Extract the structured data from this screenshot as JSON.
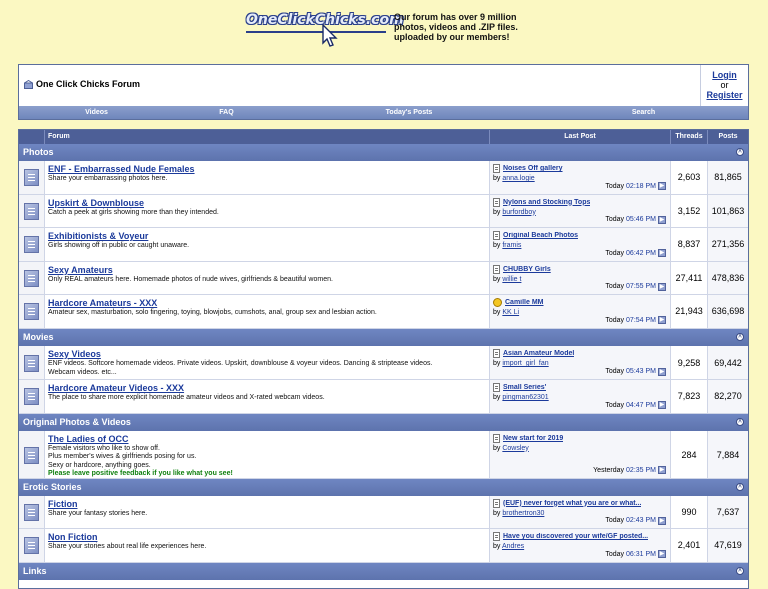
{
  "banner": {
    "logo_text": "OneClickChicks.com",
    "tagline": "Our forum has over 9 million photos, videos and .ZIP files. uploaded by our members!"
  },
  "navbox": {
    "title": "One Click Chicks Forum",
    "login": "Login",
    "or": "or",
    "register": "Register",
    "links": [
      "Videos",
      "FAQ",
      "Today's Posts",
      "Search"
    ]
  },
  "columns": {
    "forum": "Forum",
    "last_post": "Last Post",
    "threads": "Threads",
    "posts": "Posts"
  },
  "categories": [
    {
      "name": "Photos",
      "forums": [
        {
          "title": "ENF - Embarrassed Nude Females",
          "desc": [
            "Share your embarrassing photos here."
          ],
          "last_title": "Noises Off gallery",
          "by": "by",
          "last_user": "anna.logie",
          "day": "Today",
          "time": "02:18 PM",
          "threads": "2,603",
          "posts": "81,865",
          "icon": "doc"
        },
        {
          "title": "Upskirt & Downblouse",
          "desc": [
            "Catch a peek at girls showing more than they intended."
          ],
          "last_title": "Nylons and Stocking Tops",
          "by": "by",
          "last_user": "burfordboy",
          "day": "Today",
          "time": "05:46 PM",
          "threads": "3,152",
          "posts": "101,863",
          "icon": "doc"
        },
        {
          "title": "Exhibitionists & Voyeur",
          "desc": [
            "Girls showing off in public or caught unaware."
          ],
          "last_title": "Original Beach Photos",
          "by": "by",
          "last_user": "framis",
          "day": "Today",
          "time": "06:42 PM",
          "threads": "8,837",
          "posts": "271,356",
          "icon": "doc"
        },
        {
          "title": "Sexy Amateurs",
          "desc": [
            "Only REAL amateurs here. Homemade photos of nude wives, girlfriends & beautiful women."
          ],
          "last_title": "CHUBBY Girls",
          "by": "by",
          "last_user": "willie t",
          "day": "Today",
          "time": "07:55 PM",
          "threads": "27,411",
          "posts": "478,836",
          "icon": "doc"
        },
        {
          "title": "Hardcore Amateurs - XXX",
          "desc": [
            "Amateur sex, masturbation, solo fingering, toying, blowjobs, cumshots, anal, group sex and lesbian action."
          ],
          "last_title": "Camille MM",
          "by": "by",
          "last_user": "KK Li",
          "day": "Today",
          "time": "07:54 PM",
          "threads": "21,943",
          "posts": "636,698",
          "icon": "smile"
        }
      ]
    },
    {
      "name": "Movies",
      "forums": [
        {
          "title": "Sexy Videos",
          "desc": [
            "ENF videos. Softcore homemade videos. Private videos. Upskirt, downblouse & voyeur videos. Dancing & striptease videos.",
            "Webcam videos. etc..."
          ],
          "last_title": "Asian Amateur Model",
          "by": "by",
          "last_user": "import_girl_fan",
          "day": "Today",
          "time": "05:43 PM",
          "threads": "9,258",
          "posts": "69,442",
          "icon": "doc"
        },
        {
          "title": "Hardcore Amateur Videos - XXX",
          "desc": [
            "The place to share more explicit homemade amateur videos and X-rated webcam videos."
          ],
          "last_title": "Small Series'",
          "by": "by",
          "last_user": "pingman62301",
          "day": "Today",
          "time": "04:47 PM",
          "threads": "7,823",
          "posts": "82,270",
          "icon": "doc"
        }
      ]
    },
    {
      "name": "Original Photos & Videos",
      "forums": [
        {
          "title": "The Ladies of OCC",
          "desc": [
            "Female visitors who like to show off.",
            "Plus member's wives & girlfriends posing for us.",
            "Sexy or hardcore, anything goes."
          ],
          "note": "Please leave positive feedback if you like what you see!",
          "last_title": "New start for 2019",
          "by": "by",
          "last_user": "Cowsley",
          "day": "Yesterday",
          "time": "02:35 PM",
          "threads": "284",
          "posts": "7,884",
          "icon": "doc"
        }
      ]
    },
    {
      "name": "Erotic Stories",
      "forums": [
        {
          "title": "Fiction",
          "desc": [
            "Share your fantasy stories here."
          ],
          "last_title": "(EUF) never forget what you are or what...",
          "by": "by",
          "last_user": "brothertron30",
          "day": "Today",
          "time": "02:43 PM",
          "threads": "990",
          "posts": "7,637",
          "icon": "doc"
        },
        {
          "title": "Non Fiction",
          "desc": [
            "Share your stories about real life experiences here."
          ],
          "last_title": "Have you discovered your wife/GF posted...",
          "by": "by",
          "last_user": "Andres",
          "day": "Today",
          "time": "06:31 PM",
          "threads": "2,401",
          "posts": "47,619",
          "icon": "doc"
        }
      ]
    },
    {
      "name": "Links",
      "forums": []
    }
  ]
}
